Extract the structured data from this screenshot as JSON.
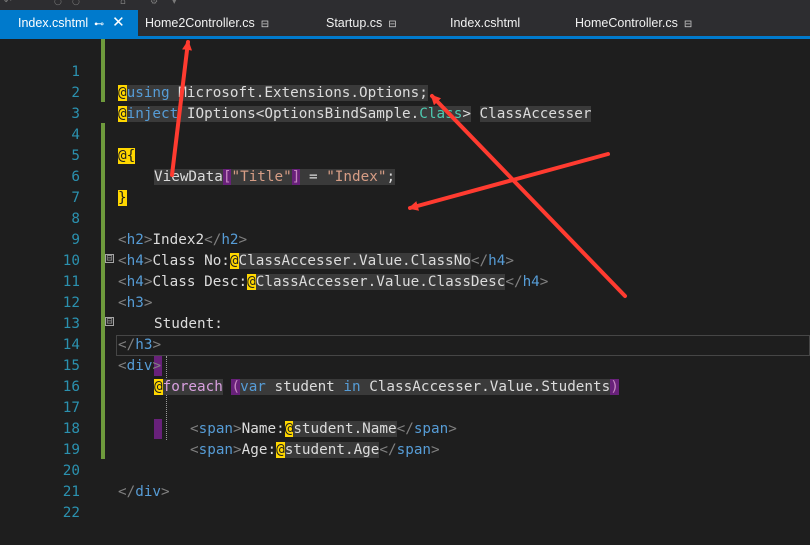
{
  "toolbar": {
    "glyphs": [
      "↶",
      "○",
      "○",
      "⌂",
      "⚙",
      "▾"
    ]
  },
  "tabs": [
    {
      "label": "Index.cshtml",
      "active": true,
      "pin": "⊷",
      "close": "✕"
    },
    {
      "label": "Home2Controller.cs",
      "pin": "⊟"
    },
    {
      "label": "Startup.cs",
      "pin": "⊟"
    },
    {
      "label": "Index.cshtml",
      "pin": ""
    },
    {
      "label": "HomeController.cs",
      "pin": "⊟"
    }
  ],
  "editor": {
    "line_numbers": [
      "1",
      "2",
      "3",
      "4",
      "5",
      "6",
      "7",
      "8",
      "9",
      "10",
      "11",
      "12",
      "13",
      "14",
      "15",
      "16",
      "17",
      "18",
      "19",
      "20",
      "21",
      "22"
    ],
    "lines": {
      "l1": {
        "at": "@",
        "kw": "using",
        "rest": " Microsoft.Extensions.Options;"
      },
      "l2": {
        "at": "@",
        "kw": "inject",
        "iface": " IOptions<OptionsBindSample.",
        "cls": "Class",
        "close": ">",
        "name": "ClassAccesser"
      },
      "l4": {
        "brace": "@{"
      },
      "l5": {
        "id": "ViewData",
        "lb": "[",
        "str": "\"Title\"",
        "rb": "]",
        "eq": " = ",
        "val": "\"Index\"",
        "semi": ";"
      },
      "l6": {
        "brace": "}"
      },
      "l8": {
        "open": "<",
        "tag": "h2",
        "gt": ">",
        "text": "Index2",
        "close": "</",
        "tag2": "h2",
        "gt2": ">"
      },
      "l9": {
        "open": "<",
        "tag": "h4",
        "gt": ">",
        "text": "Class No:",
        "at": "@",
        "expr": "ClassAccesser.Value.ClassNo",
        "close": "</",
        "tag2": "h4",
        "gt2": ">"
      },
      "l10": {
        "open": "<",
        "tag": "h4",
        "gt": ">",
        "text": "Class Desc:",
        "at": "@",
        "expr": "ClassAccesser.Value.ClassDesc",
        "close": "</",
        "tag2": "h4",
        "gt2": ">"
      },
      "l11": {
        "open": "<",
        "tag": "h3",
        "gt": ">"
      },
      "l12": {
        "text": "Student:"
      },
      "l13": {
        "close": "</",
        "tag": "h3",
        "gt": ">"
      },
      "l14": {
        "open": "<",
        "tag": "div",
        "gt": ">"
      },
      "l15": {
        "at": "@",
        "kw": "foreach",
        "lp": "(",
        "var": "var",
        "id": " student ",
        "in": "in",
        "expr": " ClassAccesser.Value.Students",
        "rp": ")"
      },
      "l17": {
        "open": "<",
        "tag": "span",
        "gt": ">",
        "text": "Name:",
        "at": "@",
        "expr": "student.Name",
        "close": "</",
        "tag2": "span",
        "gt2": ">"
      },
      "l18": {
        "open": "<",
        "tag": "span",
        "gt": ">",
        "text": "Age:",
        "at": "@",
        "expr": "student.Age",
        "close": "</",
        "tag2": "span",
        "gt2": ">"
      },
      "l20": {
        "close": "</",
        "tag": "div",
        "gt": ">"
      }
    },
    "fold_glyph": "⊟",
    "colors": {
      "background": "#1e1e1e",
      "accent": "#007acc",
      "line_number": "#2b91af",
      "arrow": "#ff3b30",
      "change_bar": "#6e9a3c"
    }
  }
}
